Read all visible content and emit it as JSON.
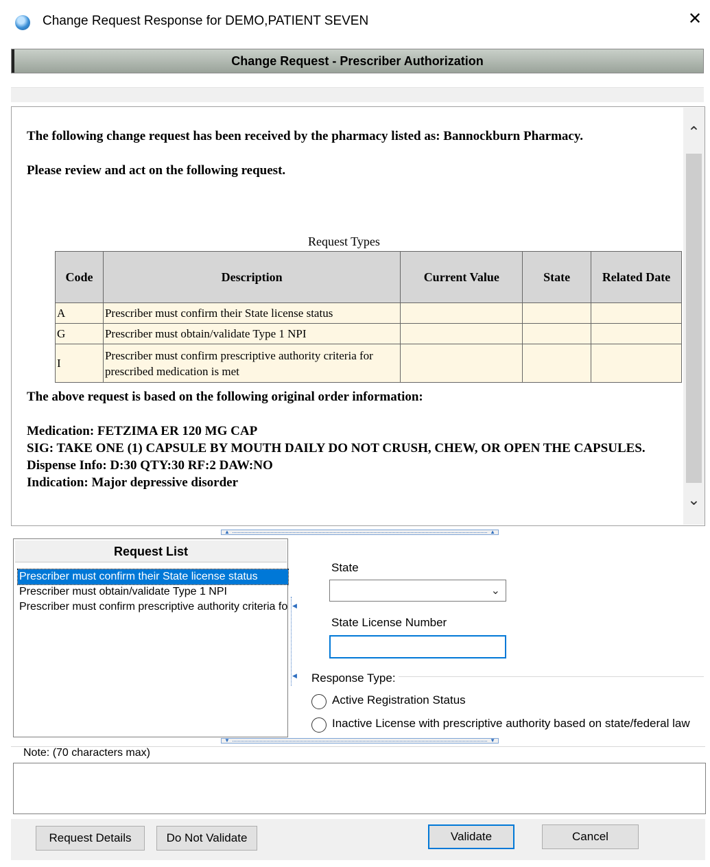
{
  "window": {
    "title": "Change Request Response for DEMO,PATIENT SEVEN",
    "close_glyph": "✕"
  },
  "header": {
    "title": "Change Request - Prescriber Authorization"
  },
  "document": {
    "intro": "The following change request has been received by the pharmacy listed as: Bannockburn Pharmacy.",
    "review": "Please review and act on the following request.",
    "table_caption": "Request Types",
    "table_headers": [
      "Code",
      "Description",
      "Current Value",
      "State",
      "Related Date"
    ],
    "rows": [
      {
        "code": "A",
        "description": "Prescriber must confirm their State license status",
        "current_value": "",
        "state": "",
        "related_date": ""
      },
      {
        "code": "G",
        "description": "Prescriber must obtain/validate Type 1 NPI",
        "current_value": "",
        "state": "",
        "related_date": ""
      },
      {
        "code": "I",
        "description": "Prescriber must confirm prescriptive authority criteria for prescribed medication is met",
        "current_value": "",
        "state": "",
        "related_date": ""
      }
    ],
    "based_on": "The above request is based on the following original order information:",
    "medication": "Medication: FETZIMA ER 120 MG CAP",
    "sig": "SIG: TAKE ONE (1) CAPSULE BY MOUTH DAILY DO NOT CRUSH, CHEW, OR OPEN THE CAPSULES.",
    "dispense": "Dispense Info: D:30 QTY:30 RF:2 DAW:NO",
    "indication": "Indication: Major depressive disorder"
  },
  "request_list": {
    "header": "Request List",
    "items": [
      "Prescriber must confirm their State license status",
      "Prescriber must obtain/validate Type 1 NPI",
      "Prescriber must confirm prescriptive authority criteria for prescribed medication is met"
    ],
    "selected_index": 0
  },
  "form": {
    "state_label": "State",
    "state_value": "",
    "license_label": "State License Number",
    "license_value": "",
    "response_type_label": "Response Type:",
    "options": [
      "Active Registration Status",
      "Inactive License with prescriptive authority based on state/federal law"
    ]
  },
  "note": {
    "label": "Note: (70 characters max)",
    "value": ""
  },
  "buttons": {
    "request_details": "Request Details",
    "do_not_validate": "Do Not Validate",
    "validate": "Validate",
    "cancel": "Cancel"
  },
  "colors": {
    "accent": "#0078d7",
    "table_header_bg": "#d6d6d6",
    "table_row_bg": "#fef7e3"
  }
}
